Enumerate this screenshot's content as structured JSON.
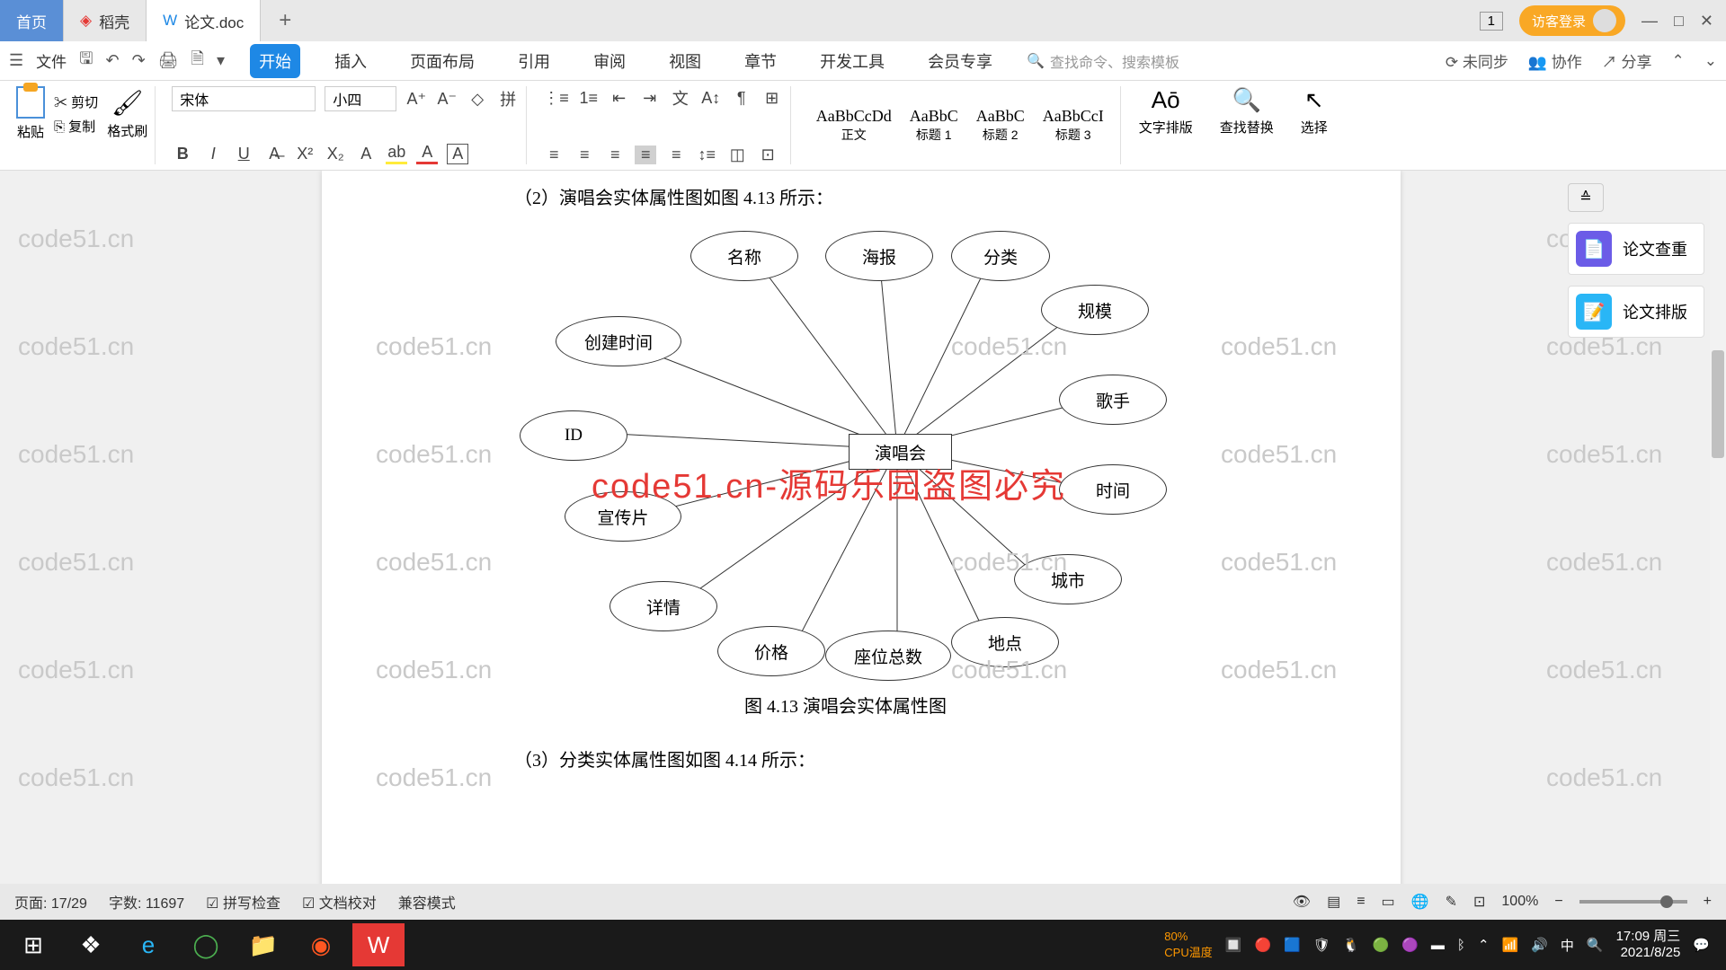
{
  "titlebar": {
    "home": "首页",
    "daoke": "稻壳",
    "doc": "论文.doc",
    "badge": "1",
    "login": "访客登录"
  },
  "menubar": {
    "file": "文件",
    "tabs": [
      "开始",
      "插入",
      "页面布局",
      "引用",
      "审阅",
      "视图",
      "章节",
      "开发工具",
      "会员专享"
    ],
    "search_ph": "查找命令、搜索模板",
    "sync": "未同步",
    "coop": "协作",
    "share": "分享"
  },
  "toolbar": {
    "paste": "粘贴",
    "cut": "剪切",
    "copy": "复制",
    "format": "格式刷",
    "font": "宋体",
    "size": "小四",
    "styles": [
      {
        "prev": "AaBbCcDd",
        "name": "正文"
      },
      {
        "prev": "AaBbC",
        "name": "标题 1"
      },
      {
        "prev": "AaBbC",
        "name": "标题 2"
      },
      {
        "prev": "AaBbCcI",
        "name": "标题 3"
      }
    ],
    "layout": "文字排版",
    "find": "查找替换",
    "select": "选择"
  },
  "document": {
    "line1": "（2）演唱会实体属性图如图 4.13 所示：",
    "caption": "图 4.13   演唱会实体属性图",
    "line2": "（3）分类实体属性图如图 4.14 所示：",
    "center": "演唱会",
    "attrs": {
      "id": "ID",
      "create": "创建时间",
      "name": "名称",
      "poster": "海报",
      "cat": "分类",
      "scale": "规模",
      "singer": "歌手",
      "time": "时间",
      "city": "城市",
      "place": "地点",
      "seats": "座位总数",
      "price": "价格",
      "detail": "详情",
      "promo": "宣传片"
    },
    "red_wm": "code51.cn-源码乐园盗图必究",
    "wm": "code51.cn"
  },
  "side": {
    "check": "论文查重",
    "format": "论文排版"
  },
  "status": {
    "page": "页面: 17/29",
    "words": "字数: 11697",
    "spell": "拼写检查",
    "proof": "文档校对",
    "compat": "兼容模式",
    "zoom": "100%",
    "cpu": "CPU温度",
    "pct": "80%"
  },
  "tray": {
    "time": "17:09 周三",
    "date": "2021/8/25",
    "ime": "中"
  }
}
